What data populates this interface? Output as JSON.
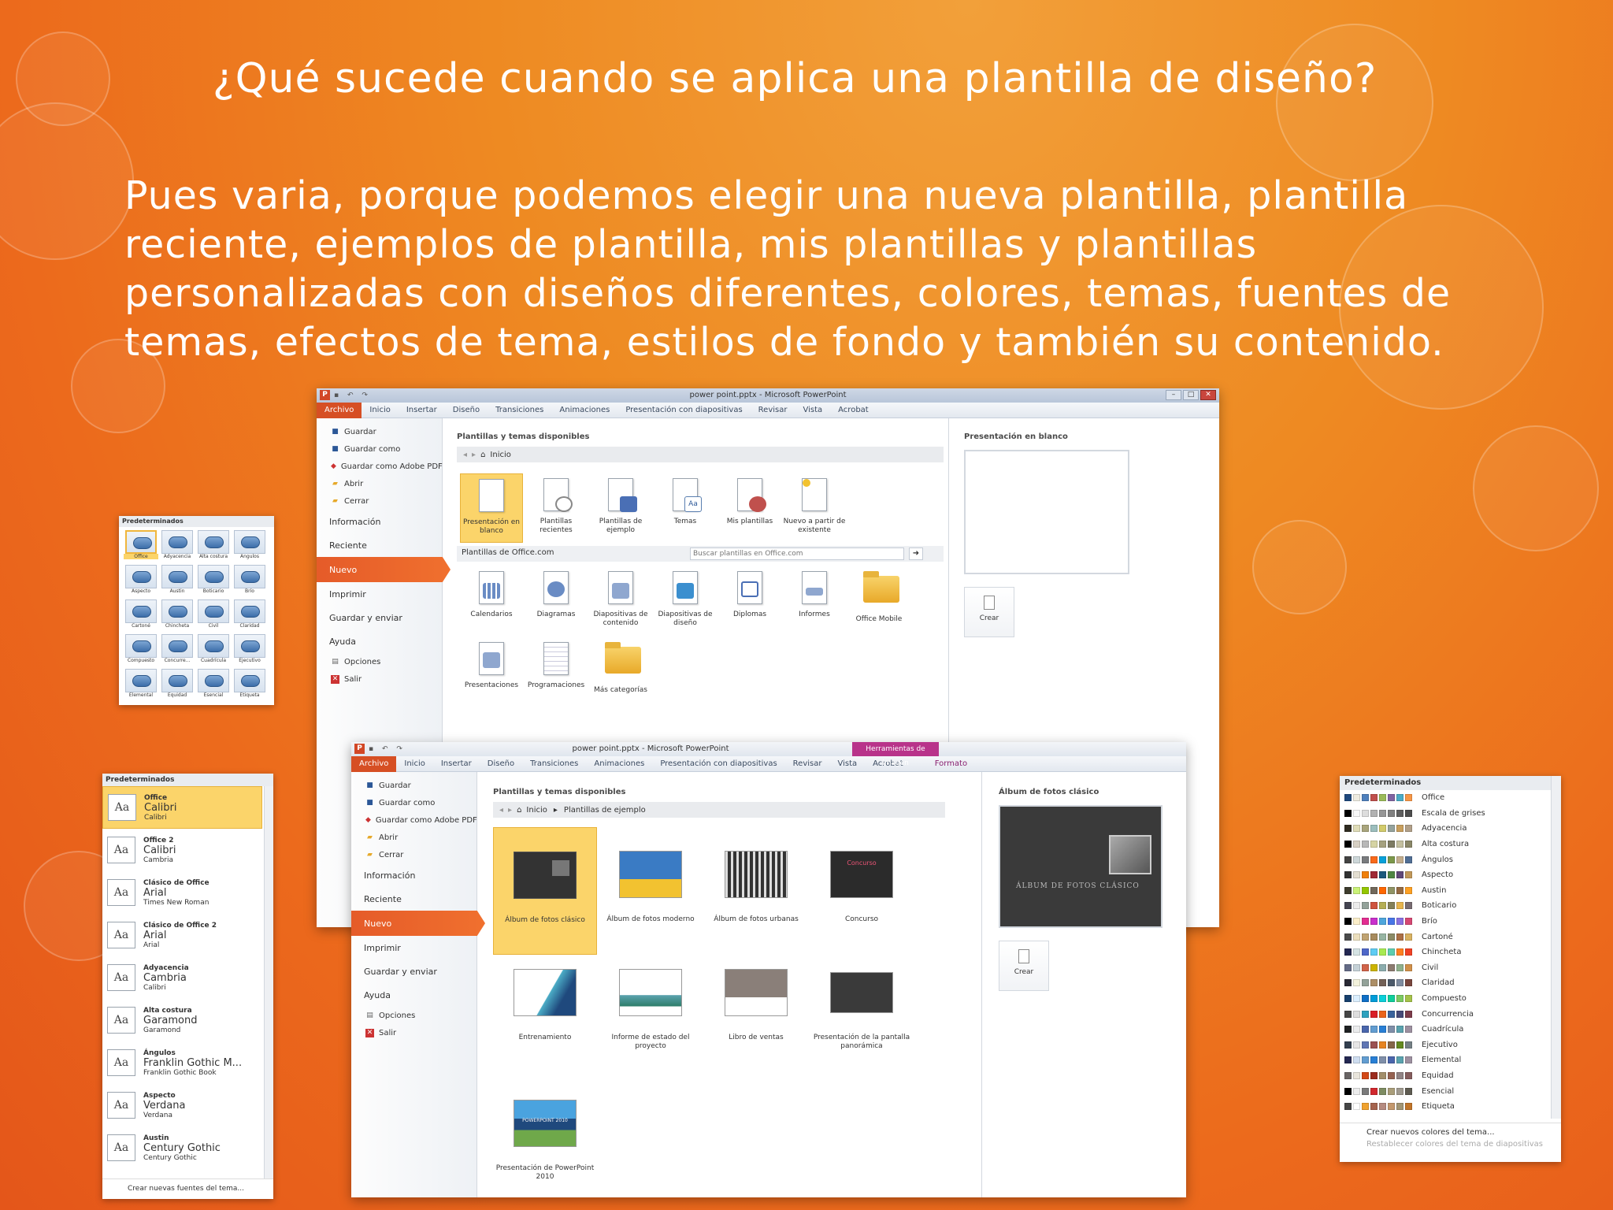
{
  "slide": {
    "title": "¿Qué sucede cuando se aplica una plantilla de diseño?",
    "body": "Pues varia, porque podemos elegir una nueva plantilla, plantilla reciente, ejemplos de plantilla, mis plantillas y plantillas personalizadas con diseños diferentes, colores, temas, fuentes de temas, efectos de tema, estilos de fondo y también su contenido."
  },
  "win1": {
    "title": "power point.pptx - Microsoft PowerPoint",
    "tabs": [
      "Archivo",
      "Inicio",
      "Insertar",
      "Diseño",
      "Transiciones",
      "Animaciones",
      "Presentación con diapositivas",
      "Revisar",
      "Vista",
      "Acrobat"
    ],
    "backstage_top": [
      "Guardar",
      "Guardar como",
      "Guardar como Adobe PDF",
      "Abrir",
      "Cerrar"
    ],
    "backstage_info": "Información",
    "backstage_recent": "Reciente",
    "backstage_new": "Nuevo",
    "backstage_print": "Imprimir",
    "backstage_share": "Guardar y enviar",
    "backstage_help": "Ayuda",
    "backstage_options": "Opciones",
    "backstage_exit": "Salir",
    "section_title": "Plantillas y temas disponibles",
    "nav_home": "Inicio",
    "tiles_top": [
      "Presentación en blanco",
      "Plantillas recientes",
      "Plantillas de ejemplo",
      "Temas",
      "Mis plantillas",
      "Nuevo a partir de existente"
    ],
    "office_com": "Plantillas de Office.com",
    "search_placeholder": "Buscar plantillas en Office.com",
    "tiles_office": [
      "Calendarios",
      "Diagramas",
      "Diapositivas de contenido",
      "Diapositivas de diseño",
      "Diplomas",
      "Informes",
      "Office Mobile",
      "Presentaciones",
      "Programaciones",
      "Más categorías"
    ],
    "preview_title": "Presentación en blanco",
    "create": "Crear"
  },
  "win2": {
    "title": "power point.pptx - Microsoft PowerPoint",
    "context_tab_group": "Herramientas de imagen",
    "tabs": [
      "Archivo",
      "Inicio",
      "Insertar",
      "Diseño",
      "Transiciones",
      "Animaciones",
      "Presentación con diapositivas",
      "Revisar",
      "Vista",
      "Acrobat",
      "Formato"
    ],
    "backstage_top": [
      "Guardar",
      "Guardar como",
      "Guardar como Adobe PDF",
      "Abrir",
      "Cerrar"
    ],
    "backstage_info": "Información",
    "backstage_recent": "Reciente",
    "backstage_new": "Nuevo",
    "backstage_print": "Imprimir",
    "backstage_share": "Guardar y enviar",
    "backstage_help": "Ayuda",
    "backstage_options": "Opciones",
    "backstage_exit": "Salir",
    "section_title": "Plantillas y temas disponibles",
    "nav_home": "Inicio",
    "nav_current": "Plantillas de ejemplo",
    "templates": [
      "Álbum de fotos clásico",
      "Álbum de fotos moderno",
      "Álbum de fotos urbanas",
      "Concurso",
      "Entrenamiento",
      "Informe de estado del proyecto",
      "Libro de ventas",
      "Presentación de la pantalla panorámica",
      "Presentación de PowerPoint 2010"
    ],
    "preview_title": "Álbum de fotos clásico",
    "preview_caption": "ÁLBUM DE FOTOS CLÁSICO",
    "contest_thumb": "Concurso",
    "ppt2010_thumb": "POWERPOINT 2010",
    "create": "Crear"
  },
  "palette": {
    "header": "Predeterminados",
    "items": [
      "Office",
      "Adyacencia",
      "Alta costura",
      "Ángulos",
      "Aspecto",
      "Austin",
      "Boticario",
      "Brío",
      "Cartoné",
      "Chincheta",
      "Civil",
      "Claridad",
      "Compuesto",
      "Concurre...",
      "Cuadrícula",
      "Ejecutivo",
      "Elemental",
      "Equidad",
      "Esencial",
      "Etiqueta"
    ]
  },
  "fonts": {
    "header": "Predeterminados",
    "aa": "Aa",
    "items": [
      {
        "name": "Office",
        "heading": "Calibri",
        "body": "Calibri"
      },
      {
        "name": "Office 2",
        "heading": "Calibri",
        "body": "Cambria"
      },
      {
        "name": "Clásico de Office",
        "heading": "Arial",
        "body": "Times New Roman"
      },
      {
        "name": "Clásico de Office 2",
        "heading": "Arial",
        "body": "Arial"
      },
      {
        "name": "Adyacencia",
        "heading": "Cambria",
        "body": "Calibri"
      },
      {
        "name": "Alta costura",
        "heading": "Garamond",
        "body": "Garamond"
      },
      {
        "name": "Ángulos",
        "heading": "Franklin Gothic M...",
        "body": "Franklin Gothic Book"
      },
      {
        "name": "Aspecto",
        "heading": "Verdana",
        "body": "Verdana"
      },
      {
        "name": "Austin",
        "heading": "Century Gothic",
        "body": "Century Gothic"
      }
    ],
    "footer": "Crear nuevas fuentes del tema..."
  },
  "colors": {
    "header": "Predeterminados",
    "items": [
      {
        "name": "Office",
        "sw": [
          "#1f497d",
          "#eeece1",
          "#4f81bd",
          "#c0504d",
          "#9bbb59",
          "#8064a2",
          "#4bacc6",
          "#f79646"
        ]
      },
      {
        "name": "Escala de grises",
        "sw": [
          "#000000",
          "#f8f8f8",
          "#dddddd",
          "#b2b2b2",
          "#969696",
          "#808080",
          "#5f5f5f",
          "#4d4d4d"
        ]
      },
      {
        "name": "Adyacencia",
        "sw": [
          "#2f2b20",
          "#dfdcb7",
          "#a9a57c",
          "#9cbebd",
          "#d2cb6c",
          "#95a39d",
          "#c89f5d",
          "#b1a089"
        ]
      },
      {
        "name": "Alta costura",
        "sw": [
          "#000000",
          "#d7d0c4",
          "#b8b8b8",
          "#d5d3a3",
          "#a5a17f",
          "#7d7b63",
          "#c4c0a0",
          "#8a8768"
        ]
      },
      {
        "name": "Ángulos",
        "sw": [
          "#434342",
          "#cdd7d9",
          "#797b7e",
          "#f96a1b",
          "#08a1d9",
          "#7c984a",
          "#c2ad8d",
          "#506e94"
        ]
      },
      {
        "name": "Aspecto",
        "sw": [
          "#323232",
          "#e3ded1",
          "#f07f09",
          "#9f2936",
          "#1b587c",
          "#4e8542",
          "#604878",
          "#c19859"
        ]
      },
      {
        "name": "Austin",
        "sw": [
          "#3e3d2d",
          "#caf278",
          "#94c600",
          "#71685a",
          "#ff6700",
          "#909465",
          "#956b43",
          "#fea022"
        ]
      },
      {
        "name": "Boticario",
        "sw": [
          "#454551",
          "#ececec",
          "#93a299",
          "#cf543f",
          "#b5ae53",
          "#848058",
          "#e8b54d",
          "#786c71"
        ]
      },
      {
        "name": "Brío",
        "sw": [
          "#000000",
          "#fbeec9",
          "#e32d91",
          "#c830cc",
          "#4ea6dc",
          "#4775e7",
          "#8971e1",
          "#d54773"
        ]
      },
      {
        "name": "Cartoné",
        "sw": [
          "#4b4b4b",
          "#ecdfbd",
          "#c0a371",
          "#a78b5e",
          "#97b5a3",
          "#8b8a66",
          "#ab6f45",
          "#d9b261"
        ]
      },
      {
        "name": "Chincheta",
        "sw": [
          "#242852",
          "#d5e3e4",
          "#4e67c8",
          "#5eccf3",
          "#a7ea52",
          "#5dceaf",
          "#ff8021",
          "#f14124"
        ]
      },
      {
        "name": "Civil",
        "sw": [
          "#646b86",
          "#c5d1d7",
          "#d16349",
          "#ccb400",
          "#8cadae",
          "#8c7b70",
          "#8fb08c",
          "#d19049"
        ]
      },
      {
        "name": "Claridad",
        "sw": [
          "#292934",
          "#f3f2dc",
          "#93a299",
          "#ad8f67",
          "#726056",
          "#4c5a6a",
          "#808da0",
          "#79463d"
        ]
      },
      {
        "name": "Compuesto",
        "sw": [
          "#17406d",
          "#dbefff",
          "#0f6fc6",
          "#009dd9",
          "#0bd0d9",
          "#10cf9b",
          "#7cca62",
          "#a5c249"
        ]
      },
      {
        "name": "Concurrencia",
        "sw": [
          "#464646",
          "#dedede",
          "#2da2bf",
          "#da1f28",
          "#eb641b",
          "#39639d",
          "#474b78",
          "#7d3c4a"
        ]
      },
      {
        "name": "Cuadrícula",
        "sw": [
          "#1f2123",
          "#ebeced",
          "#4a66ac",
          "#629dd1",
          "#297fd5",
          "#7f8fa9",
          "#5aa2ae",
          "#9d90a0"
        ]
      },
      {
        "name": "Ejecutivo",
        "sw": [
          "#333f4f",
          "#e7e6e6",
          "#6076b4",
          "#9c5252",
          "#e68422",
          "#846648",
          "#63891f",
          "#758085"
        ]
      },
      {
        "name": "Elemental",
        "sw": [
          "#242852",
          "#ceddf0",
          "#629dd1",
          "#297fd5",
          "#7f8fa9",
          "#4a66ac",
          "#5aa2ae",
          "#9d90a0"
        ]
      },
      {
        "name": "Equidad",
        "sw": [
          "#696464",
          "#e9e5dc",
          "#d34817",
          "#9b2d1f",
          "#a28e6a",
          "#956251",
          "#918485",
          "#855d5d"
        ]
      },
      {
        "name": "Esencial",
        "sw": [
          "#000000",
          "#ececec",
          "#7a7a7a",
          "#d1282e",
          "#7e8c62",
          "#aa9e7a",
          "#a09b90",
          "#5e5b51"
        ]
      },
      {
        "name": "Etiqueta",
        "sw": [
          "#464646",
          "#ffffff",
          "#f0a22e",
          "#a5644e",
          "#b58b80",
          "#c3986d",
          "#a19574",
          "#c17529"
        ]
      }
    ],
    "footer1": "Crear nuevos colores del tema...",
    "footer2": "Restablecer colores del tema de diapositivas"
  }
}
